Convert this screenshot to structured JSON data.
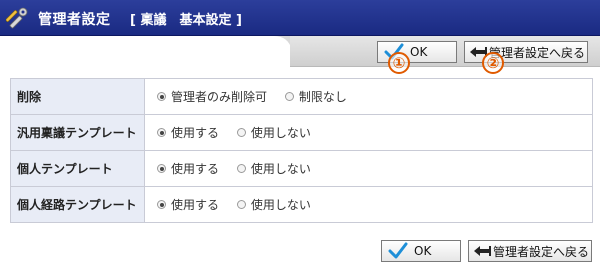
{
  "header": {
    "title": "管理者設定",
    "subtitle": "[ 稟議　基本設定 ]"
  },
  "toolbar": {
    "ok_label": "OK",
    "back_label": "管理者設定へ戻る",
    "marker_ok": "①",
    "marker_back": "②"
  },
  "settings": [
    {
      "label": "削除",
      "options": [
        "管理者のみ削除可",
        "制限なし"
      ],
      "selected": 0
    },
    {
      "label": "汎用稟議テンプレート",
      "options": [
        "使用する",
        "使用しない"
      ],
      "selected": 0
    },
    {
      "label": "個人テンプレート",
      "options": [
        "使用する",
        "使用しない"
      ],
      "selected": 0
    },
    {
      "label": "個人経路テンプレート",
      "options": [
        "使用する",
        "使用しない"
      ],
      "selected": 0
    }
  ],
  "footer": {
    "ok_label": "OK",
    "back_label": "管理者設定へ戻る"
  },
  "colors": {
    "title_bar": "#1f2f8a",
    "label_cell": "#e8ecf6",
    "marker": "#e05a00",
    "check": "#1e8fd8"
  },
  "icons": {
    "title": "tools-icon",
    "ok": "check-icon",
    "back": "back-arrow-icon"
  }
}
